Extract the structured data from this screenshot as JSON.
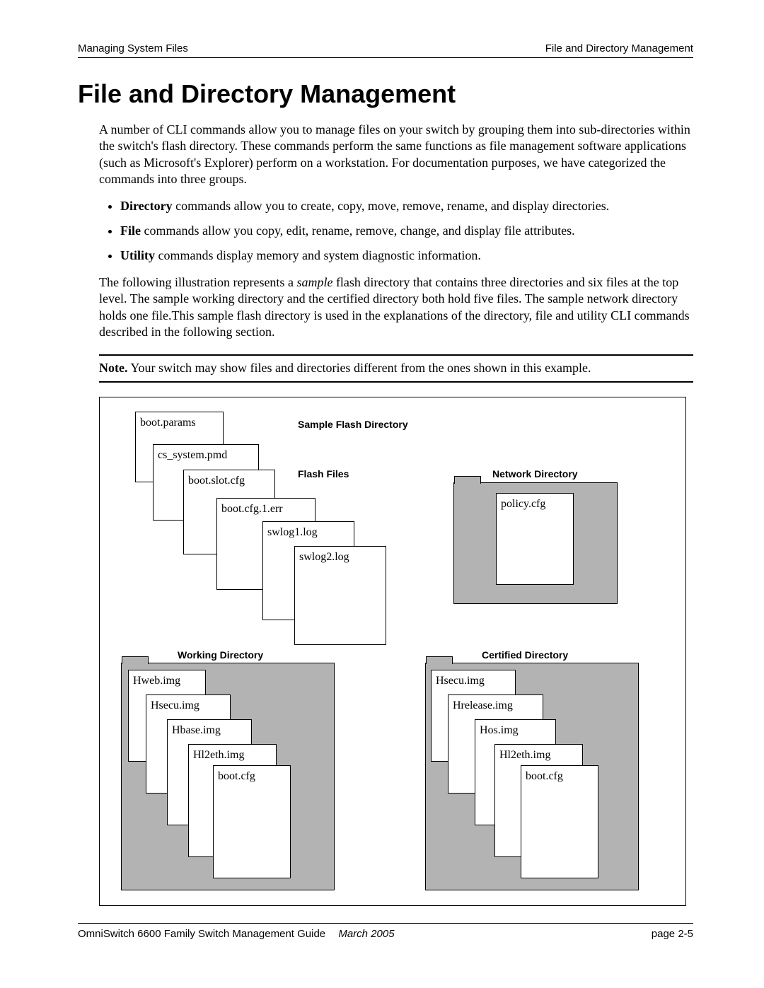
{
  "header": {
    "left": "Managing System Files",
    "right": "File and Directory Management"
  },
  "title": "File and Directory Management",
  "intro": "A number of CLI commands allow you to manage files on your switch by grouping them into sub-directories within the switch's flash directory. These commands perform the same functions as file management software applications (such as Microsoft's Explorer) perform on a workstation. For documentation purposes, we have categorized the commands into three groups.",
  "bullets": {
    "b1_bold": "Directory",
    "b1_rest": " commands allow you to create, copy, move, remove, rename, and display directories.",
    "b2_bold": "File",
    "b2_rest": " commands allow you copy, edit, rename, remove, change, and display file attributes.",
    "b3_bold": "Utility",
    "b3_rest": " commands display memory and system diagnostic information."
  },
  "para2_a": "The following illustration represents a ",
  "para2_em": "sample",
  "para2_b": " flash directory that contains three directories and six files at the top level. The sample working directory and the certified directory both hold five files. The sample network directory holds one file.This sample flash directory is used in the explanations of the directory, file and utility CLI commands described in the following section.",
  "note_bold": "Note.",
  "note_rest": " Your switch may show files and directories different from the ones shown in this example.",
  "diagram": {
    "labels": {
      "sample": "Sample Flash Directory",
      "flash": "Flash Files",
      "network": "Network Directory",
      "working": "Working Directory",
      "certified": "Certified Directory"
    },
    "flash_files": [
      "boot.params",
      "cs_system.pmd",
      "boot.slot.cfg",
      "boot.cfg.1.err",
      "swlog1.log",
      "swlog2.log"
    ],
    "network_files": [
      "policy.cfg"
    ],
    "working_files": [
      "Hweb.img",
      "Hsecu.img",
      "Hbase.img",
      "Hl2eth.img",
      "boot.cfg"
    ],
    "certified_files": [
      "Hsecu.img",
      "Hrelease.img",
      "Hos.img",
      "Hl2eth.img",
      "boot.cfg"
    ]
  },
  "footer": {
    "guide": "OmniSwitch 6600 Family Switch Management Guide",
    "date": "March 2005",
    "page": "page 2-5"
  }
}
